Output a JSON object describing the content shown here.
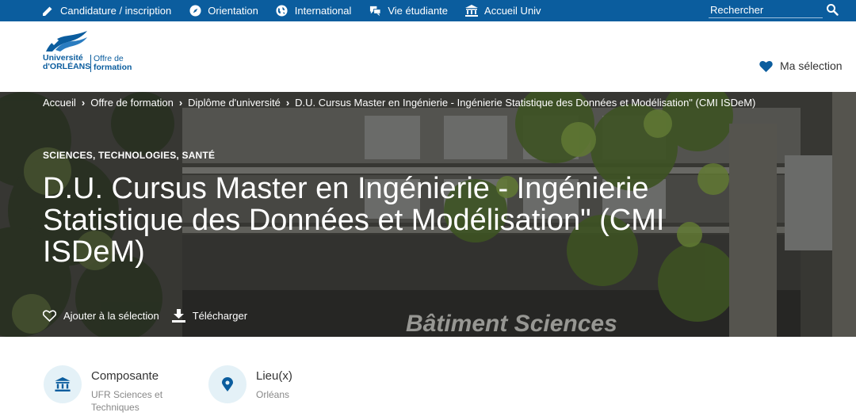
{
  "topbar": {
    "items": [
      {
        "label": "Candidature / inscription",
        "icon": "pencil-icon"
      },
      {
        "label": "Orientation",
        "icon": "compass-icon"
      },
      {
        "label": "International",
        "icon": "globe-icon"
      },
      {
        "label": "Vie étudiante",
        "icon": "chat-bubbles-icon"
      },
      {
        "label": "Accueil Univ",
        "icon": "university-building-icon"
      }
    ],
    "search_placeholder": "Rechercher"
  },
  "header": {
    "logo_line1": "Université",
    "logo_line2": "d'ORLÉANS",
    "logo_offre1": "Offre de",
    "logo_offre2": "formation",
    "selection_label": "Ma sélection"
  },
  "breadcrumb": [
    "Accueil",
    "Offre de formation",
    "Diplôme d'université",
    "D.U. Cursus Master en Ingénierie - Ingénierie Statistique des Données et Modélisation\" (CMI ISDeM)"
  ],
  "hero": {
    "category": "SCIENCES, TECHNOLOGIES, SANTÉ",
    "title": "D.U. Cursus Master en Ingénierie - Ingénierie Statistique des Données et Modélisation\" (CMI ISDeM)",
    "building_sign": "Bâtiment Sciences",
    "add_selection": "Ajouter à la sélection",
    "download": "Télécharger"
  },
  "info": {
    "composante_head": "Composante",
    "composante_val": "UFR Sciences et Techniques",
    "lieu_head": "Lieu(x)",
    "lieu_val": "Orléans"
  },
  "colors": {
    "brand_blue": "#0b5d9e",
    "icon_circle_bg": "#e4f1f7"
  }
}
